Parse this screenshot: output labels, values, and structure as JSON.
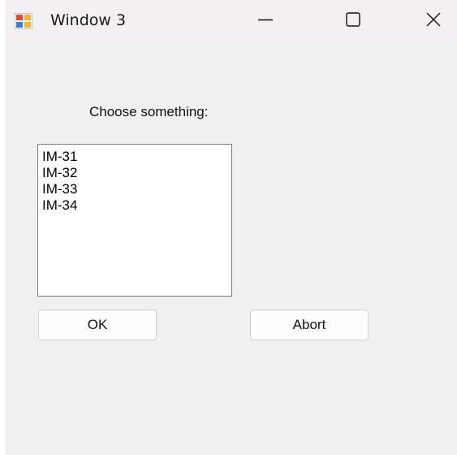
{
  "window": {
    "title": "Window 3",
    "icon": "app-window-icon",
    "controls": {
      "minimize_icon": "minimize-icon",
      "maximize_icon": "maximize-icon",
      "close_icon": "close-icon"
    }
  },
  "dialog": {
    "prompt": "Choose something:",
    "list_items": [
      "IM-31",
      "IM-32",
      "IM-33",
      "IM-34"
    ],
    "ok_label": "OK",
    "abort_label": "Abort"
  },
  "colors": {
    "window_bg": "#f0f0f0",
    "titlebar_bg": "#f3eff3",
    "listbox_bg": "#ffffff",
    "button_bg": "#fdfdfd"
  }
}
